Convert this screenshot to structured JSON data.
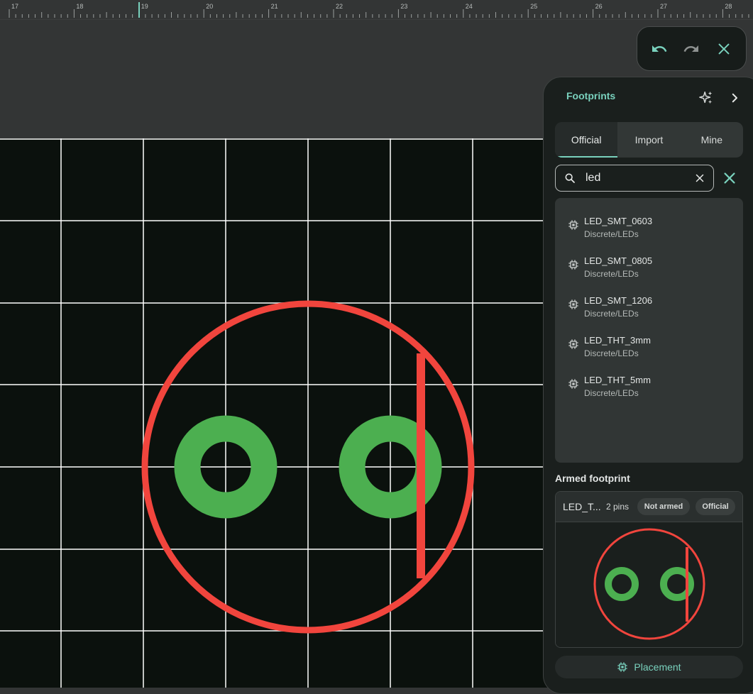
{
  "ruler": {
    "labels": [
      "17",
      "18",
      "19",
      "20",
      "21",
      "22",
      "23",
      "24",
      "25",
      "26",
      "27",
      "28"
    ]
  },
  "history": {
    "undo_icon": "undo-icon",
    "redo_icon": "redo-icon",
    "close_icon": "close-icon"
  },
  "panel": {
    "title": "Footprints",
    "icons": {
      "sparkle": "sparkle-icon",
      "collapse": "chevron-right-icon"
    },
    "tabs": [
      {
        "label": "Official",
        "active": true
      },
      {
        "label": "Import",
        "active": false
      },
      {
        "label": "Mine",
        "active": false
      }
    ],
    "search": {
      "value": "led",
      "placeholder": ""
    },
    "results": [
      {
        "name": "LED_SMT_0603",
        "category": "Discrete/LEDs"
      },
      {
        "name": "LED_SMT_0805",
        "category": "Discrete/LEDs"
      },
      {
        "name": "LED_SMT_1206",
        "category": "Discrete/LEDs"
      },
      {
        "name": "LED_THT_3mm",
        "category": "Discrete/LEDs"
      },
      {
        "name": "LED_THT_5mm",
        "category": "Discrete/LEDs"
      }
    ],
    "armed": {
      "heading": "Armed footprint",
      "name": "LED_T...",
      "pins": "2 pins",
      "status": "Not armed",
      "source": "Official"
    },
    "placement_label": "Placement"
  },
  "colors": {
    "accent": "#79d1bd",
    "outline": "#f1453d",
    "pad": "#4caf50",
    "canvas": "#0b110d",
    "panel": "#1a1f1d"
  }
}
